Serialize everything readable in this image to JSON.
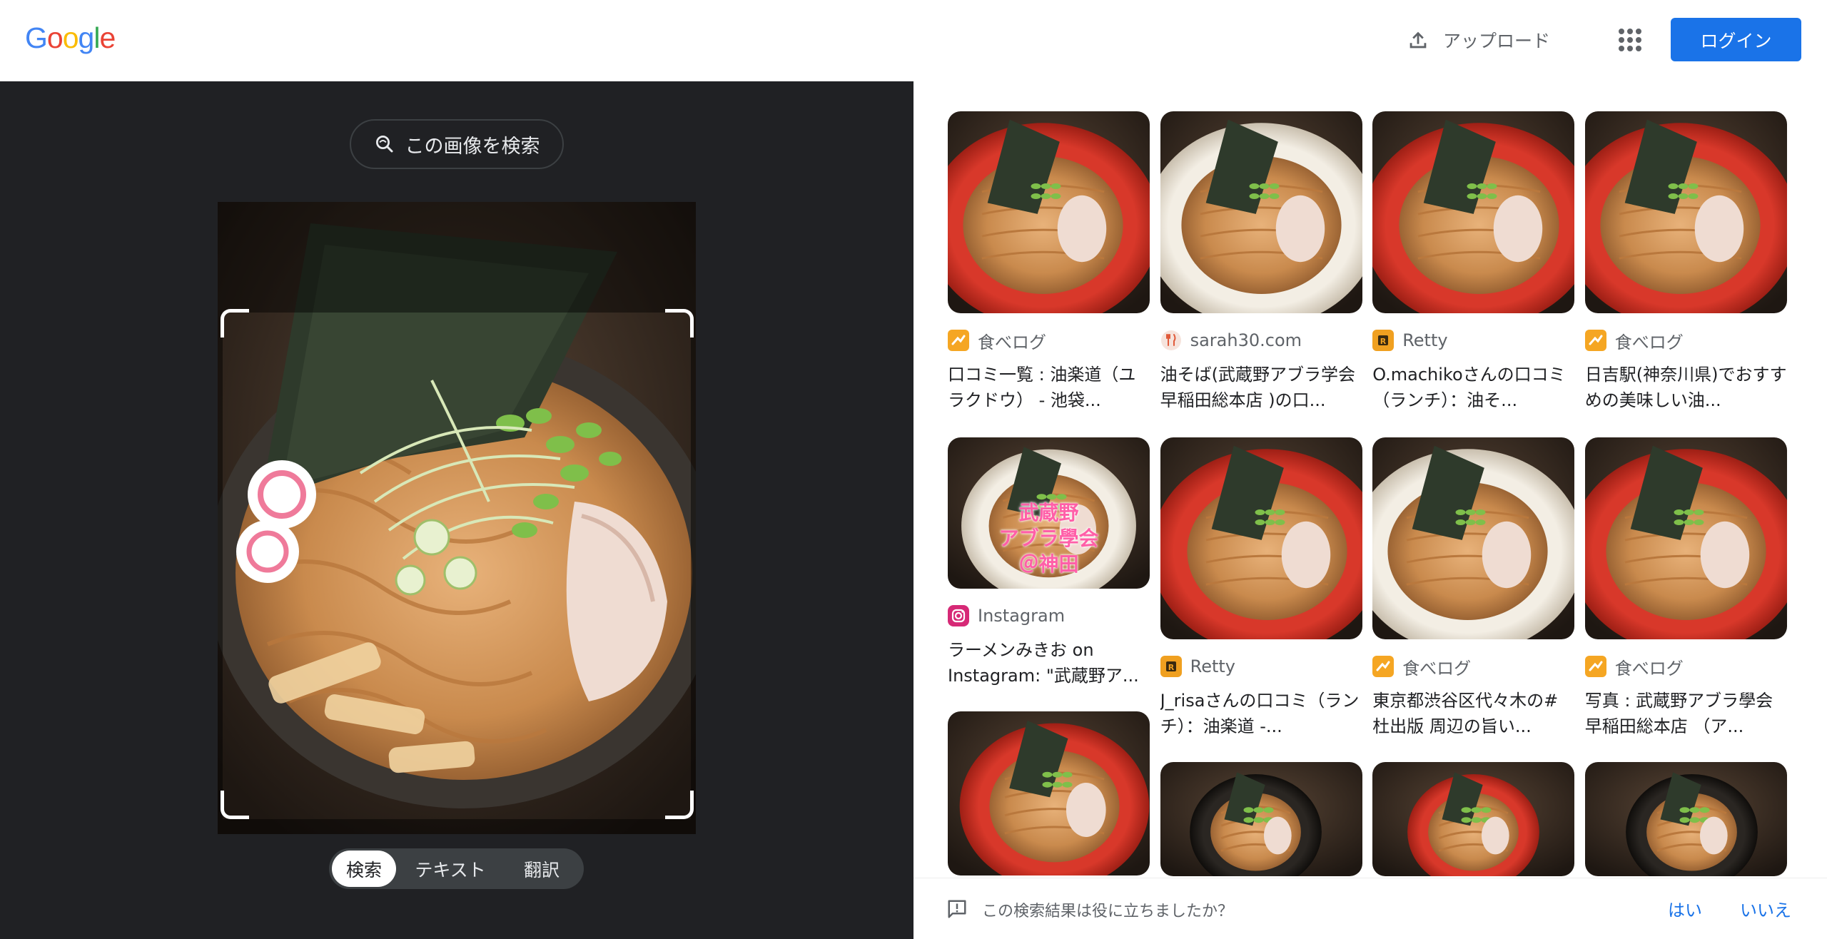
{
  "header": {
    "logo_letters": [
      {
        "ch": "G",
        "color": "#4285F4"
      },
      {
        "ch": "o",
        "color": "#EA4335"
      },
      {
        "ch": "o",
        "color": "#FBBC05"
      },
      {
        "ch": "g",
        "color": "#4285F4"
      },
      {
        "ch": "l",
        "color": "#34A853"
      },
      {
        "ch": "e",
        "color": "#EA4335"
      }
    ],
    "upload_label": "アップロード",
    "apps_icon": "apps-grid-icon",
    "login_label": "ログイン"
  },
  "left": {
    "search_image_label": "この画像を検索",
    "modes": [
      {
        "label": "検索",
        "active": true
      },
      {
        "label": "テキスト",
        "active": false
      },
      {
        "label": "翻訳",
        "active": false
      }
    ]
  },
  "results": {
    "columns": [
      [
        {
          "source": "食べログ",
          "favicon": "tabelog",
          "title": "口コミ一覧 : 油楽道（ユラクドウ） - 池袋..."
        },
        {
          "source": "Instagram",
          "favicon": "instagram",
          "title": "ラーメンみきお on Instagram: \"武蔵野ア...",
          "overlay": "武蔵野\nアブラ學会\n＠神田"
        },
        {
          "source": "",
          "favicon": "",
          "title": ""
        }
      ],
      [
        {
          "source": "sarah30.com",
          "favicon": "sarah",
          "title": "油そば(武蔵野アブラ学会 早稲田総本店 )の口..."
        },
        {
          "source": "Retty",
          "favicon": "retty",
          "title": "J_risaさんの口コミ（ランチ）：油楽道 -..."
        },
        {
          "source": "",
          "favicon": "",
          "title": ""
        }
      ],
      [
        {
          "source": "Retty",
          "favicon": "retty",
          "title": "O.machikoさんの口コミ（ランチ）：油そ..."
        },
        {
          "source": "食べログ",
          "favicon": "tabelog",
          "title": "東京都渋谷区代々木の#杜出版 周辺の旨い..."
        },
        {
          "source": "",
          "favicon": "",
          "title": ""
        }
      ],
      [
        {
          "source": "食べログ",
          "favicon": "tabelog",
          "title": "日吉駅(神奈川県)でおすすめの美味しい油..."
        },
        {
          "source": "食べログ",
          "favicon": "tabelog",
          "title": "写真 : 武蔵野アブラ學会 早稲田総本店 （ア..."
        },
        {
          "source": "",
          "favicon": "",
          "title": ""
        }
      ]
    ]
  },
  "feedback": {
    "question": "この検索結果は役に立ちましたか？",
    "yes": "はい",
    "no": "いいえ"
  },
  "colors": {
    "accent": "#1a73e8",
    "dark_bg": "#202124",
    "tabelog": "#f5a623",
    "retty": "#f0a020",
    "instagram": "#d62976",
    "sarah": "#e05a3a"
  }
}
